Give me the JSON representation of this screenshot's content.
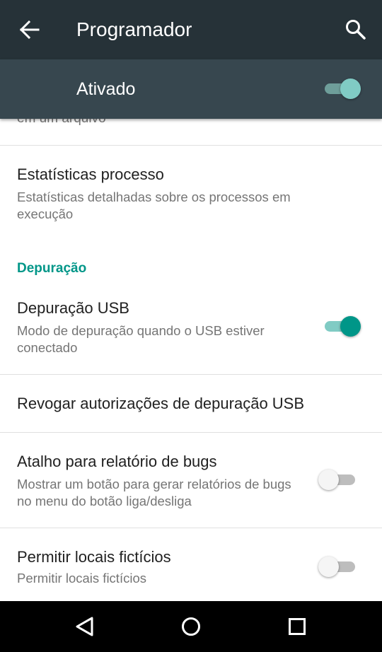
{
  "appbar": {
    "title": "Programador"
  },
  "master": {
    "label": "Ativado",
    "enabled": true
  },
  "cutoff_text": "em um arquivo",
  "items": [
    {
      "title": "Estatísticas processo",
      "subtitle": "Estatísticas detalhadas sobre os processos em execução"
    },
    {
      "category": "Depuração"
    },
    {
      "title": "Depuração USB",
      "subtitle": "Modo de depuração quando o USB estiver conectado",
      "toggle": true
    },
    {
      "title": "Revogar autorizações de depuração USB"
    },
    {
      "title": "Atalho para relatório de bugs",
      "subtitle": "Mostrar um botão para gerar relatórios de bugs no menu do botão liga/desliga",
      "toggle": false
    },
    {
      "title": "Permitir locais fictícios",
      "subtitle": "Permitir locais fictícios",
      "toggle": false
    }
  ],
  "icons": {
    "back": "arrow-back-icon",
    "search": "search-icon",
    "nav_back": "triangle-back-icon",
    "nav_home": "circle-home-icon",
    "nav_recents": "square-recents-icon"
  },
  "colors": {
    "accent": "#009688",
    "appbar": "#263238",
    "masterbar": "#37474F"
  }
}
